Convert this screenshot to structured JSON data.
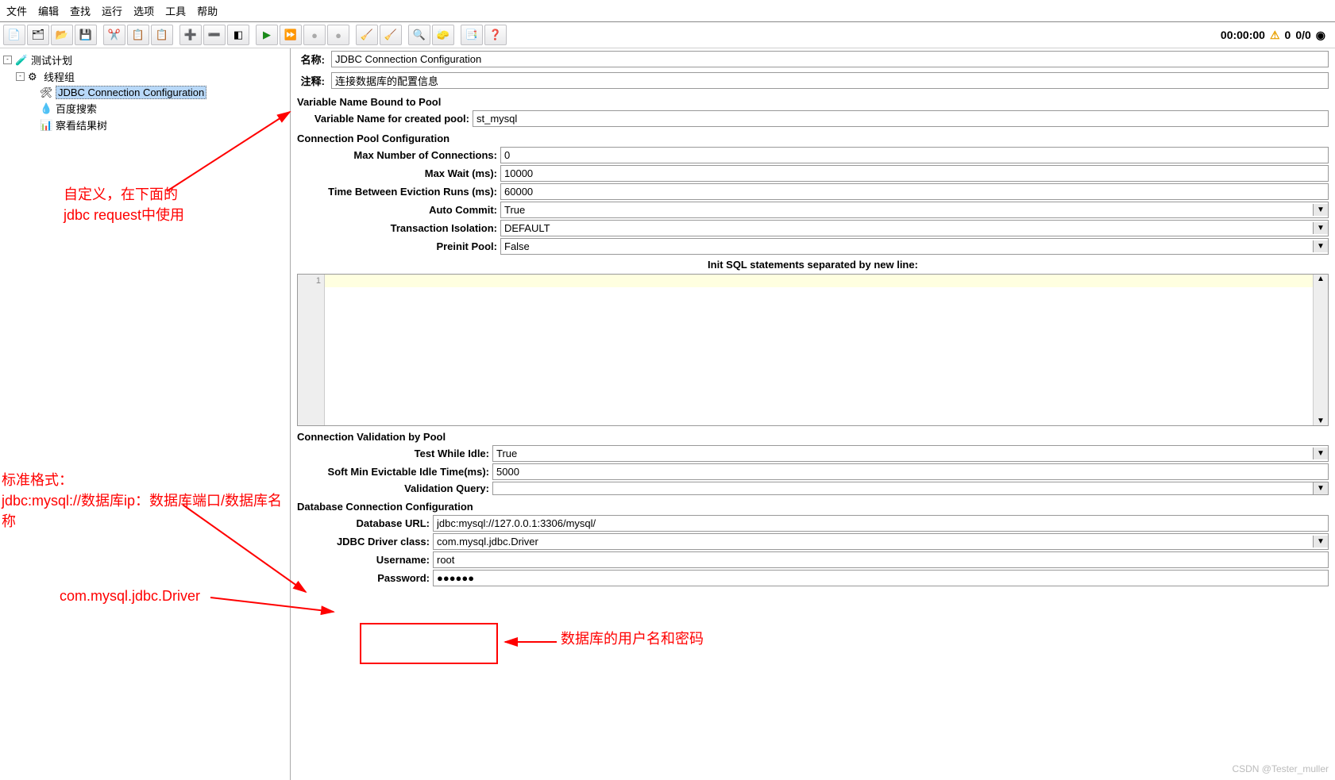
{
  "menu": [
    "文件",
    "编辑",
    "查找",
    "运行",
    "选项",
    "工具",
    "帮助"
  ],
  "timer": "00:00:00",
  "warn_count": "0",
  "run_count": "0/0",
  "tree": {
    "n0": "测试计划",
    "n1": "线程组",
    "n2": "JDBC Connection Configuration",
    "n3": "百度搜索",
    "n4": "察看结果树"
  },
  "form": {
    "name_label": "名称:",
    "name_value": "JDBC Connection Configuration",
    "comment_label": "注释:",
    "comment_value": "连接数据库的配置信息",
    "sec1": "Variable Name Bound to Pool",
    "var_label": "Variable Name for created pool:",
    "var_value": "st_mysql",
    "sec2": "Connection Pool Configuration",
    "max_conn_label": "Max Number of Connections:",
    "max_conn_value": "0",
    "max_wait_label": "Max Wait (ms):",
    "max_wait_value": "10000",
    "evict_label": "Time Between Eviction Runs (ms):",
    "evict_value": "60000",
    "autocommit_label": "Auto Commit:",
    "autocommit_value": "True",
    "iso_label": "Transaction Isolation:",
    "iso_value": "DEFAULT",
    "preinit_label": "Preinit Pool:",
    "preinit_value": "False",
    "initsql_label": "Init SQL statements separated by new line:",
    "gutter1": "1",
    "sec3": "Connection Validation by Pool",
    "testidle_label": "Test While Idle:",
    "testidle_value": "True",
    "softmin_label": "Soft Min Evictable Idle Time(ms):",
    "softmin_value": "5000",
    "valq_label": "Validation Query:",
    "sec4": "Database Connection Configuration",
    "dburl_label": "Database URL:",
    "dburl_value": "jdbc:mysql://127.0.0.1:3306/mysql/",
    "driver_label": "JDBC Driver class:",
    "driver_value": "com.mysql.jdbc.Driver",
    "user_label": "Username:",
    "user_value": "root",
    "pass_label": "Password:",
    "pass_value": "●●●●●●"
  },
  "annot": {
    "a1_l1": "自定义，在下面的",
    "a1_l2": "jdbc request中使用",
    "a2_l1": "标准格式：",
    "a2_l2": "jdbc:mysql://数据库ip：数据库端口/数据库名称",
    "a3": "com.mysql.jdbc.Driver",
    "a4": "数据库的用户名和密码"
  },
  "watermark": "CSDN @Tester_muller"
}
